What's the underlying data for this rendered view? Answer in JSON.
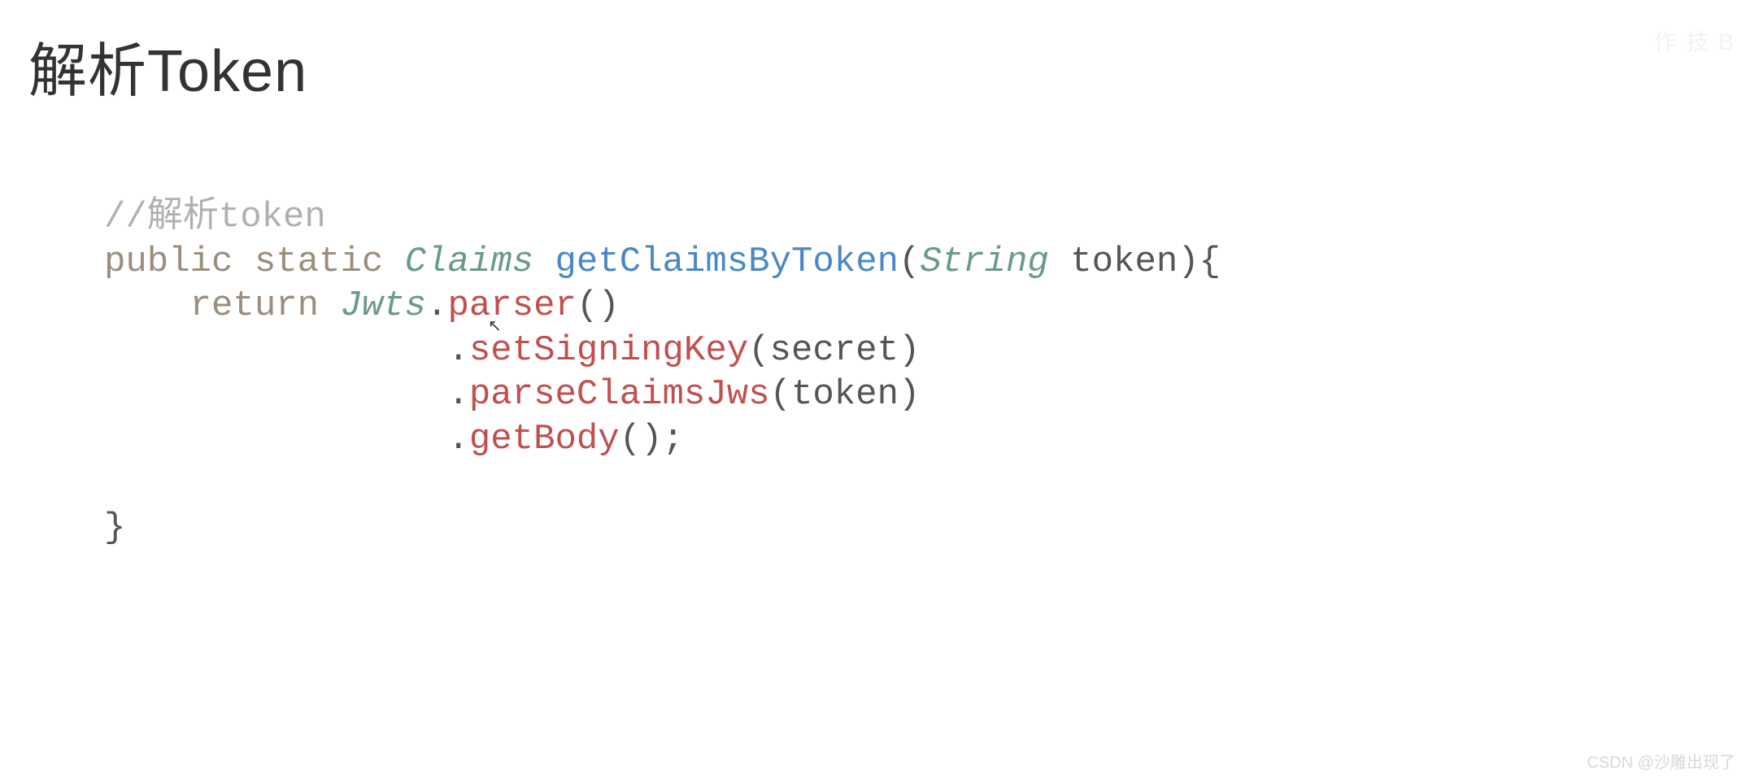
{
  "title": "解析Token",
  "corner": "作 技 B",
  "watermark": "CSDN @沙雕出现了",
  "code": {
    "line1_comment": "//解析token",
    "line2_public": "public",
    "line2_static": "static",
    "line2_claims": "Claims",
    "line2_method": "getClaimsByToken",
    "line2_string": "String",
    "line2_param": " token){",
    "line3_indent": "    ",
    "line3_return": "return",
    "line3_jwts": "Jwts",
    "line3_dot": ".",
    "line3_parser": "parser",
    "line3_paren": "()",
    "line4_indent": "                .",
    "line4_method": "setSigningKey",
    "line4_args": "(secret)",
    "line5_indent": "                .",
    "line5_method": "parseClaimsJws",
    "line5_args": "(token)",
    "line6_indent": "                .",
    "line6_method": "getBody",
    "line6_args": "();",
    "line7_brace": "}"
  }
}
